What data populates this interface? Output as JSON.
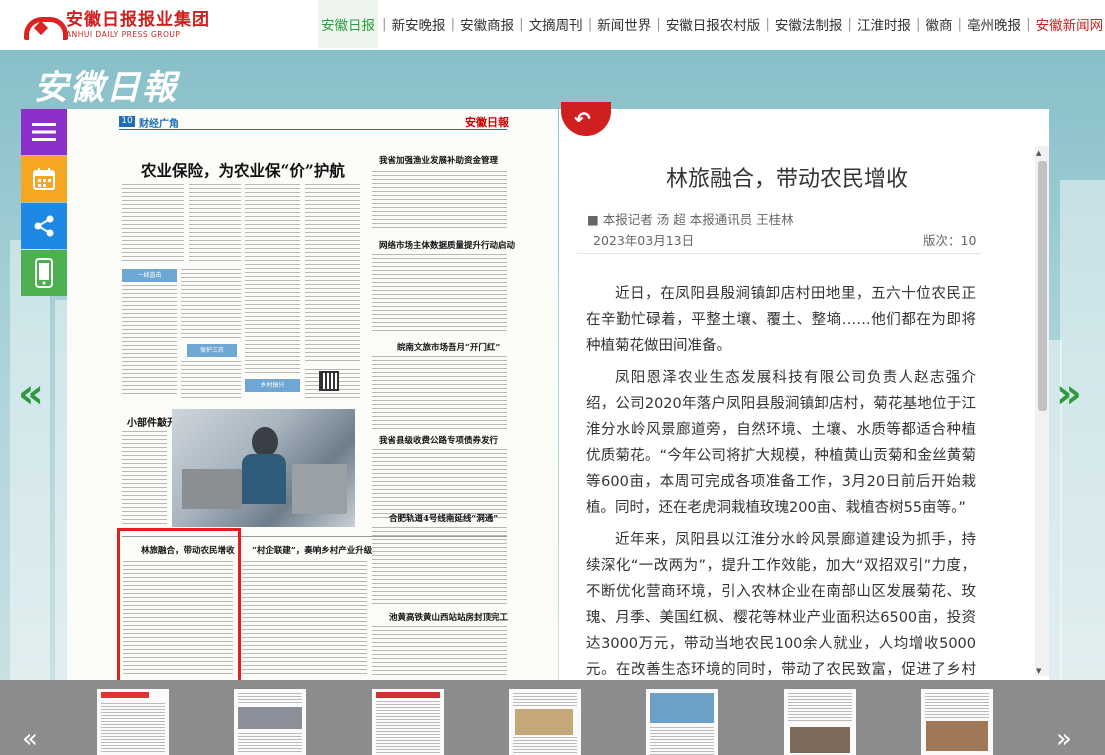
{
  "header": {
    "logo_cn": "安徽日报报业集团",
    "logo_en": "ANHUI DAILY PRESS GROUP",
    "nav": [
      {
        "label": "安徽日报"
      },
      {
        "label": "新安晚报"
      },
      {
        "label": "安徽商报"
      },
      {
        "label": "文摘周刊"
      },
      {
        "label": "新闻世界"
      },
      {
        "label": "安徽日报农村版"
      },
      {
        "label": "安徽法制报"
      },
      {
        "label": "江淮时报"
      },
      {
        "label": "徽商"
      },
      {
        "label": "亳州晚报"
      },
      {
        "label": "安徽新闻网"
      }
    ],
    "active_index": 0
  },
  "brand": "安徽日報",
  "side_tools": {
    "menu_icon": "menu-icon",
    "calendar_icon": "calendar-icon",
    "share_icon": "share-icon",
    "mobile_icon": "mobile-icon"
  },
  "paper": {
    "edition": "10",
    "section": "财经广角",
    "masthead": "安徽日報",
    "headline_main": "农业保险，为农业保“价”护航",
    "headline_r1": "我省加强渔业发展补助资金管理",
    "headline_r2": "网络市场主体数据质量提升行动启动",
    "headline_r3": "皖南文旅市场吾月“开门红”",
    "headline_r4": "我省县级收费公路专项债券发行",
    "headline_r5": "合肥轨道4号线南延线“洞通”",
    "headline_r6": "池黄高铁黄山西站站房封顶完工",
    "headline_photo": "小部件敲开大市场",
    "headline_b1": "林旅融合，带动农民增收",
    "headline_b2": "“村企联建”，奏响乡村产业升级",
    "band1": "一线直击",
    "band2": "保护三农",
    "band3": "乡村振兴"
  },
  "article": {
    "title": "林旅融合，带动农民增收",
    "author": "■ 本报记者 汤 超 本报通讯员 王桂林",
    "date": "2023年03月13日",
    "edition": "版次：10",
    "paragraphs": [
      "近日，在凤阳县殷涧镇卸店村田地里，五六十位农民正在辛勤忙碌着，平整土壤、覆土、整墒……他们都在为即将种植菊花做田间准备。",
      "凤阳恩泽农业生态发展科技有限公司负责人赵志强介绍，公司2020年落户凤阳县殷涧镇卸店村，菊花基地位于江淮分水岭风景廊道旁，自然环境、土壤、水质等都适合种植优质菊花。“今年公司将扩大规模，种植黄山贡菊和金丝黄菊等600亩，本周可完成各项准备工作，3月20日前后开始栽植。同时，还在老虎洞栽植玫瑰200亩、栽植杏树55亩等。”",
      "近年来，凤阳县以江淮分水岭风景廊道建设为抓手，持续深化“一改两为”，提升工作效能，加大“双招双引”力度，不断优化营商环境，引入农林企业在南部山区发展菊花、玫瑰、月季、美国红枫、樱花等林业产业面积达6500亩，投资达3000万元，带动当地农民100余人就业，人均增收5000元。在改善生态环境的同时，带动了农民致富，促进了乡村振兴。"
    ]
  },
  "thumbnails_count": 7,
  "colors": {
    "accent_green": "#2e9a3b",
    "brand_red": "#d01f1f"
  }
}
